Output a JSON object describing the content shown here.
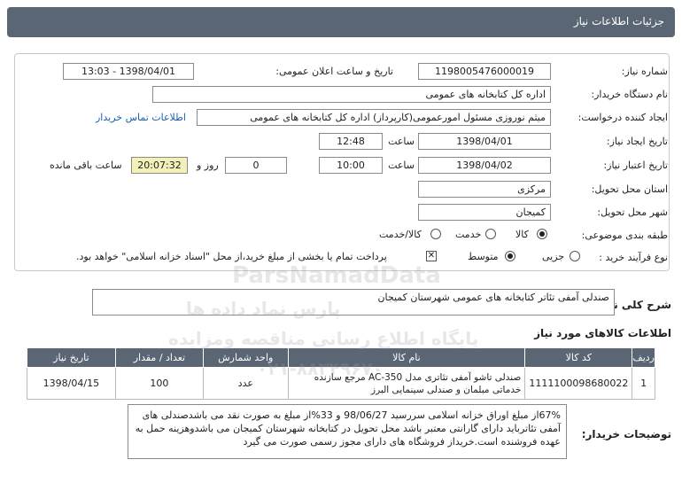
{
  "header": {
    "title": "جزئیات اطلاعات نیاز"
  },
  "form": {
    "need_number_label": "شماره نیاز:",
    "need_number": "1198005476000019",
    "announce_label": "تاریخ و ساعت اعلان عمومی:",
    "announce_value": "1398/04/01 - 13:03",
    "buyer_org_label": "نام دستگاه خریدار:",
    "buyer_org": "اداره کل کتابخانه های عمومی",
    "requester_label": "ایجاد کننده درخواست:",
    "requester": "میثم نوروزی مسئول امورعمومی(کارپرداز) اداره کل کتابخانه های عمومی",
    "contact_link": "اطلاعات تماس خریدار",
    "created_date_label": "تاریخ ایجاد نیاز:",
    "created_date": "1398/04/01",
    "time_label": "ساعت",
    "created_time": "12:48",
    "validity_label": "تاریخ اعتبار نیاز:",
    "validity_date": "1398/04/02",
    "validity_time": "10:00",
    "days_value": "0",
    "days_label": "روز و",
    "remaining_time": "20:07:32",
    "remaining_label": "ساعت باقی مانده",
    "province_label": "استان محل تحویل:",
    "province": "مرکزی",
    "city_label": "شهر محل تحویل:",
    "city": "کمیجان",
    "category_label": "طبقه بندی موضوعی:",
    "category_options": [
      "کالا",
      "خدمت",
      "کالا/خدمت"
    ],
    "process_label": "نوع فرآیند خرید :",
    "process_options": [
      "جزیی",
      "متوسط"
    ],
    "payment_note": "پرداخت تمام یا بخشی از مبلغ خرید،از محل \"اسناد خزانه اسلامی\" خواهد بود."
  },
  "summary": {
    "label": "شرح کلی نیاز:",
    "value": "صندلی آمفی تئاتر کتابخانه های عمومی شهرستان کمیجان"
  },
  "items_section": {
    "title": "اطلاعات کالاهای مورد نیاز",
    "columns": [
      "ردیف",
      "کد کالا",
      "نام کالا",
      "واحد شمارش",
      "تعداد / مقدار",
      "تاریخ نیاز"
    ],
    "rows": [
      {
        "index": "1",
        "code": "1111100098680022",
        "name": "صندلی تاشو آمفی تئاتری مدل AC-350 مرجع سازنده خدماتی مبلمان و صندلی سینمایی البرز",
        "unit": "عدد",
        "qty": "100",
        "date": "1398/04/15"
      }
    ]
  },
  "buyer_desc": {
    "label": "توضیحات خریدار:",
    "value": "67%از مبلغ اوراق خزانه اسلامی سررسید 98/06/27 و 33%از مبلغ به صورت نقد می باشدصندلی های آمفی تئاترباید دارای گارانتی معتبر باشد محل تحویل در کتابخانه شهرستان کمیجان می باشدوهزینه حمل به عهده فروشنده است.خریداز فروشگاه های دارای مجوز رسمی صورت می گیرد"
  },
  "watermarks": [
    "ParsNamadData",
    "پارس نماد داده ها",
    "پایگاه اطلاع رسانی مناقصه ومزایده",
    "۰۲۱-۸۸۳۴۹۶۷۰"
  ]
}
